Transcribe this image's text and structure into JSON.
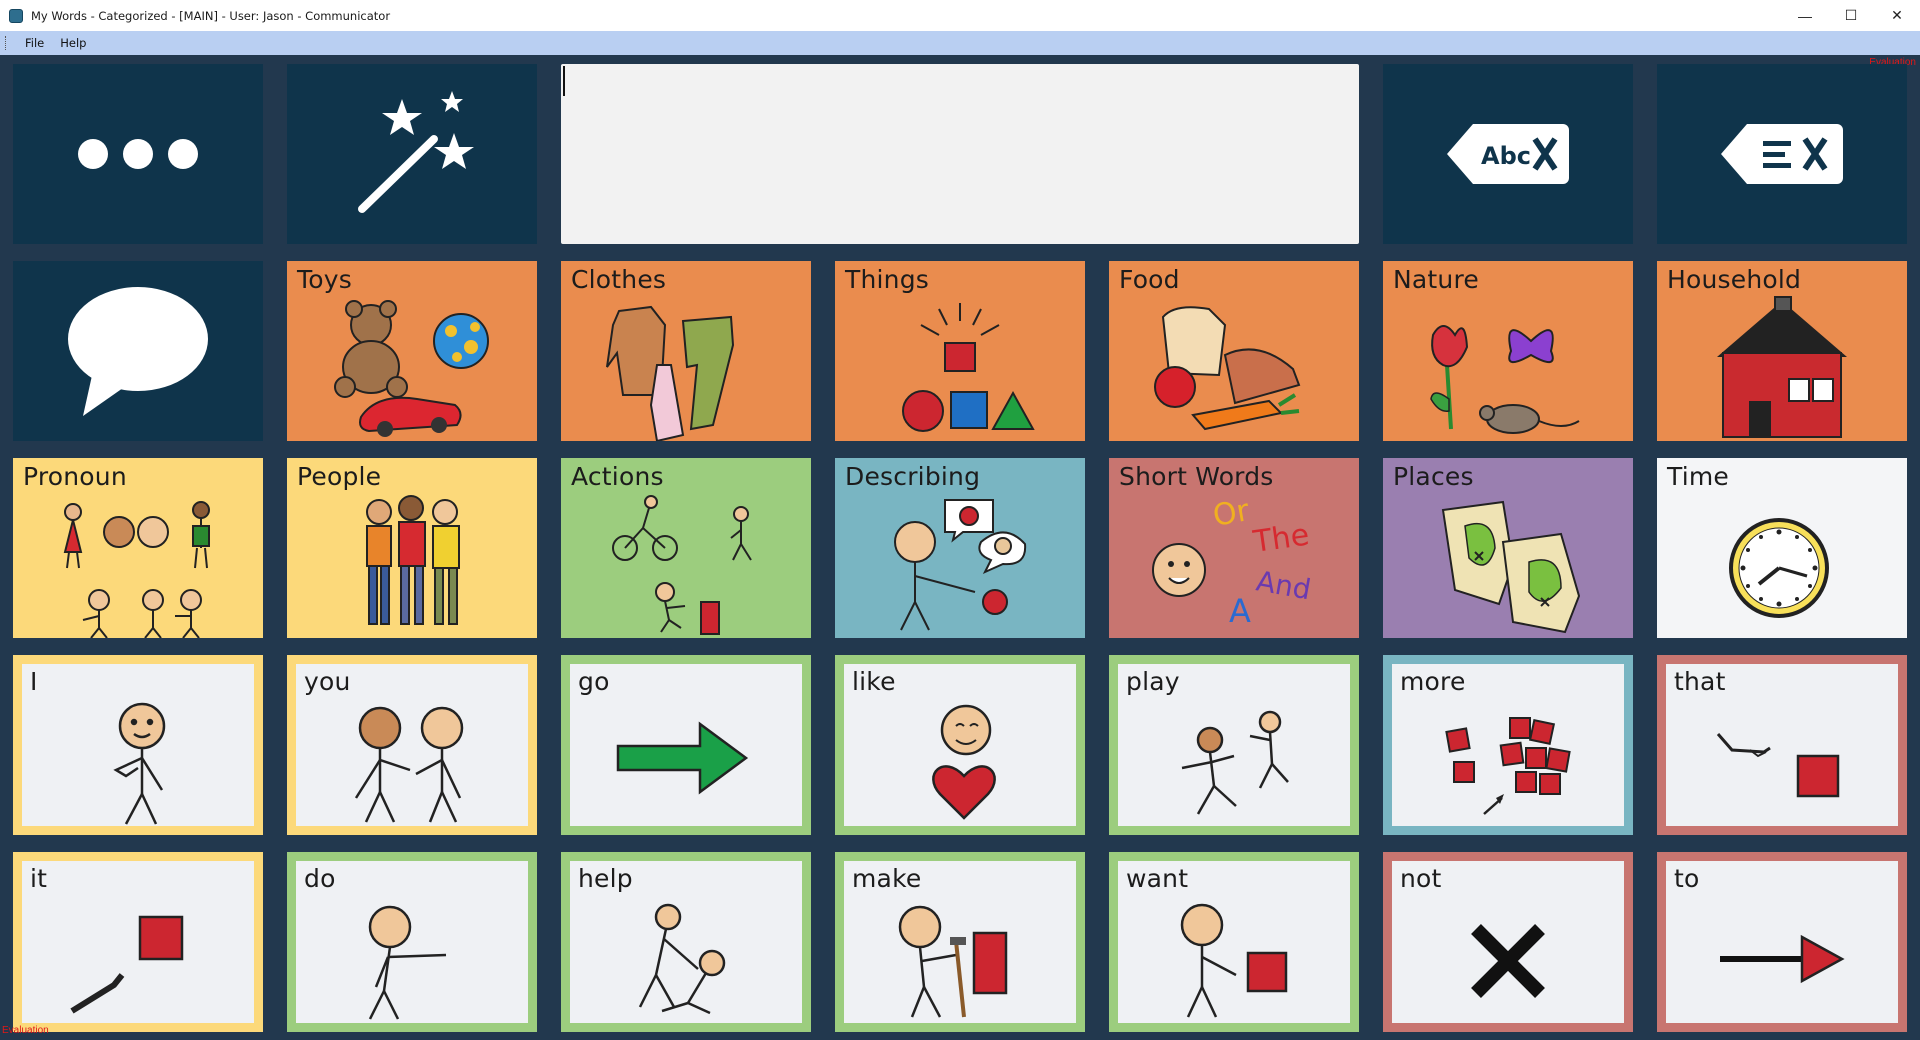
{
  "window": {
    "title": "My Words - Categorized -  [MAIN] - User: Jason - Communicator",
    "minimize": "—",
    "maximize": "☐",
    "close": "✕"
  },
  "menu": {
    "file": "File",
    "help": "Help"
  },
  "watermark": "Evaluation",
  "message_bar": {
    "text": ""
  },
  "toolbar": {
    "more_icon": "ellipsis-icon",
    "magic_icon": "magic-wand-icon",
    "clear_word_icon": "backspace-abc-icon",
    "clear_all_icon": "backspace-lines-icon",
    "speak_icon": "speech-bubble-icon"
  },
  "colors": {
    "background": "#22384e",
    "dark_tile": "#0f344b",
    "noun_category": "#ea8c4e",
    "pronoun": "#fcd97a",
    "action": "#9ccd7e",
    "describing": "#79b5c2",
    "short_words": "#c87570",
    "places": "#9a7fb0",
    "time": "#f4f5f7"
  },
  "categories": [
    {
      "label": "Toys"
    },
    {
      "label": "Clothes"
    },
    {
      "label": "Things"
    },
    {
      "label": "Food"
    },
    {
      "label": "Nature"
    },
    {
      "label": "Household"
    },
    {
      "label": "Pronoun"
    },
    {
      "label": "People"
    },
    {
      "label": "Actions"
    },
    {
      "label": "Describing"
    },
    {
      "label": "Short Words"
    },
    {
      "label": "Places"
    },
    {
      "label": "Time"
    }
  ],
  "short_words_art": [
    "Or",
    "The",
    "And",
    "A"
  ],
  "words": [
    {
      "label": "I"
    },
    {
      "label": "you"
    },
    {
      "label": "go"
    },
    {
      "label": "like"
    },
    {
      "label": "play"
    },
    {
      "label": "more"
    },
    {
      "label": "that"
    },
    {
      "label": "it"
    },
    {
      "label": "do"
    },
    {
      "label": "help"
    },
    {
      "label": "make"
    },
    {
      "label": "want"
    },
    {
      "label": "not"
    },
    {
      "label": "to"
    }
  ]
}
